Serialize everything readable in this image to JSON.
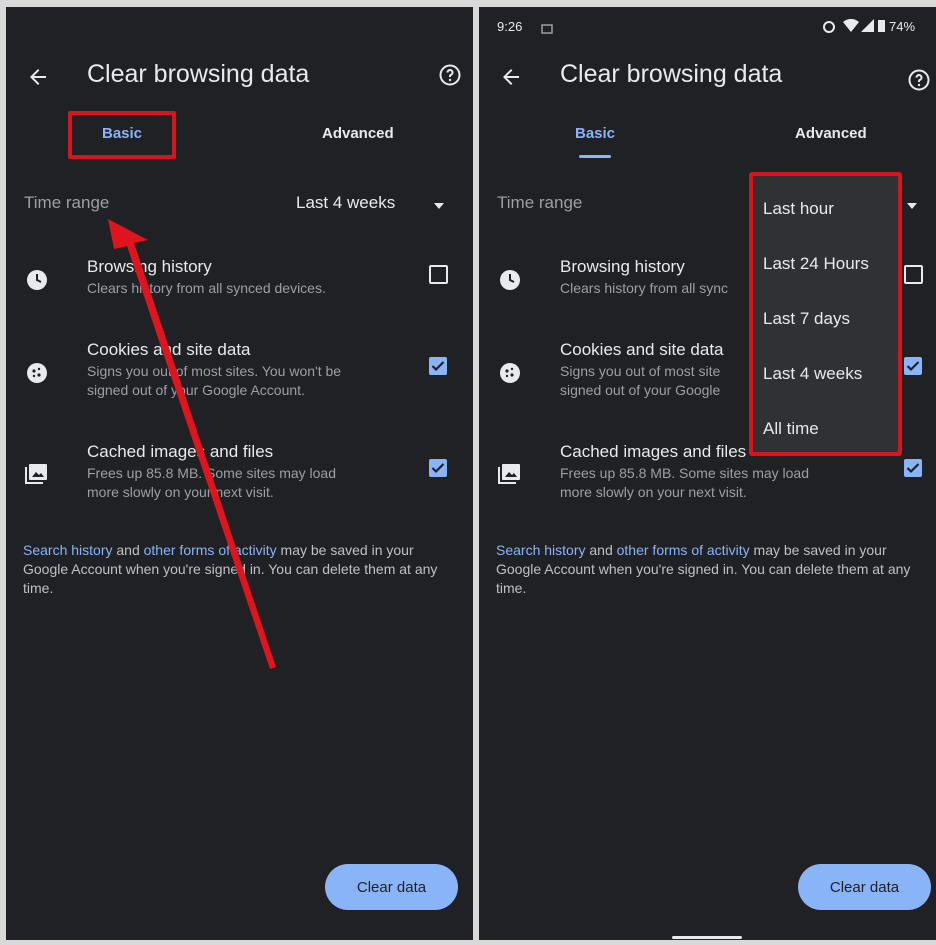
{
  "left": {
    "title": "Clear browsing data",
    "tabs": {
      "basic": "Basic",
      "advanced": "Advanced"
    },
    "time_range": {
      "label": "Time range",
      "value": "Last 4 weeks"
    },
    "items": [
      {
        "title": "Browsing history",
        "desc": [
          "Clears history from all synced devices."
        ],
        "checked": false
      },
      {
        "title": "Cookies and site data",
        "desc": [
          "Signs you out of most sites. You won't be",
          "signed out of your Google Account."
        ],
        "checked": true
      },
      {
        "title": "Cached images and files",
        "desc": [
          "Frees up 85.8 MB. Some sites may load",
          "more slowly on your next visit."
        ],
        "checked": true
      }
    ],
    "footer": {
      "link1": "Search history",
      "text1": " and ",
      "link2": "other forms of activity",
      "text2": " may be saved in your Google Account when you're signed in. You can delete them at any time."
    },
    "clear_button": "Clear data"
  },
  "right": {
    "status": {
      "time": "9:26",
      "battery": "74%"
    },
    "title": "Clear browsing data",
    "tabs": {
      "basic": "Basic",
      "advanced": "Advanced"
    },
    "time_range": {
      "label": "Time range"
    },
    "items": [
      {
        "title": "Browsing history",
        "desc": [
          "Clears history from all sync"
        ],
        "checked": false
      },
      {
        "title": "Cookies and site data",
        "desc": [
          "Signs you out of most site",
          "signed out of your Google"
        ],
        "checked": true
      },
      {
        "title": "Cached images and files",
        "desc": [
          "Frees up 85.8 MB. Some sites may load",
          "more slowly on your next visit."
        ],
        "checked": true
      }
    ],
    "dropdown_options": [
      "Last hour",
      "Last 24 Hours",
      "Last 7 days",
      "Last 4 weeks",
      "All time"
    ],
    "footer": {
      "link1": "Search history",
      "text1": " and ",
      "link2": "other forms of activity",
      "text2": " may be saved in your Google Account when you're signed in. You can delete them at any time."
    },
    "clear_button": "Clear data"
  },
  "colors": {
    "accent": "#8ab4f8",
    "background": "#202124",
    "highlight": "#d8141c"
  }
}
